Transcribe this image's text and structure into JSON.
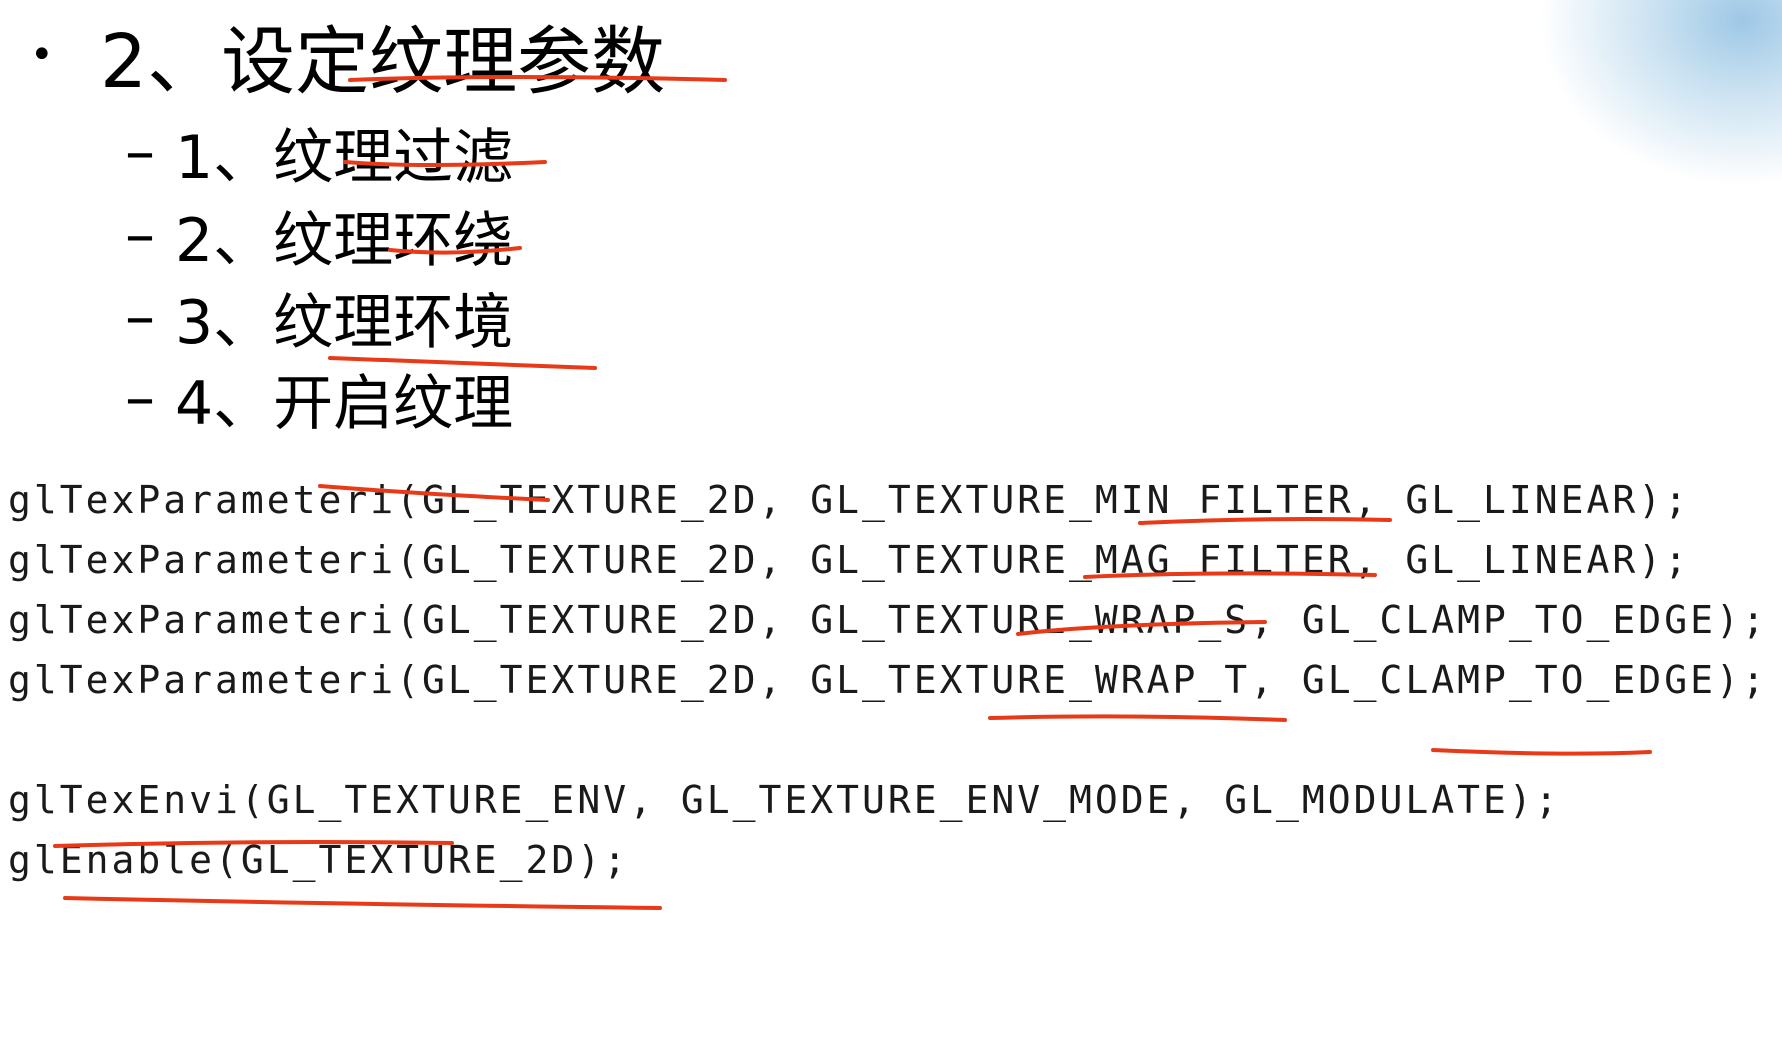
{
  "outline": {
    "bullet": "•",
    "heading": "2、设定纹理参数",
    "dash": "–",
    "items": [
      {
        "label": "1、纹理过滤"
      },
      {
        "label": "2、纹理环绕"
      },
      {
        "label": "3、纹理环境"
      },
      {
        "label": "4、开启纹理"
      }
    ]
  },
  "code": {
    "lines": [
      "glTexParameteri(GL_TEXTURE_2D, GL_TEXTURE_MIN_FILTER, GL_LINEAR);",
      "glTexParameteri(GL_TEXTURE_2D, GL_TEXTURE_MAG_FILTER, GL_LINEAR);",
      "glTexParameteri(GL_TEXTURE_2D, GL_TEXTURE_WRAP_S, GL_CLAMP_TO_EDGE);",
      "glTexParameteri(GL_TEXTURE_2D, GL_TEXTURE_WRAP_T, GL_CLAMP_TO_EDGE);",
      "glTexEnvi(GL_TEXTURE_ENV, GL_TEXTURE_ENV_MODE, GL_MODULATE);",
      "glEnable(GL_TEXTURE_2D);"
    ]
  },
  "colors": {
    "annotation_stroke": "#e83a18",
    "corner_accent": "#9ec8e6"
  }
}
